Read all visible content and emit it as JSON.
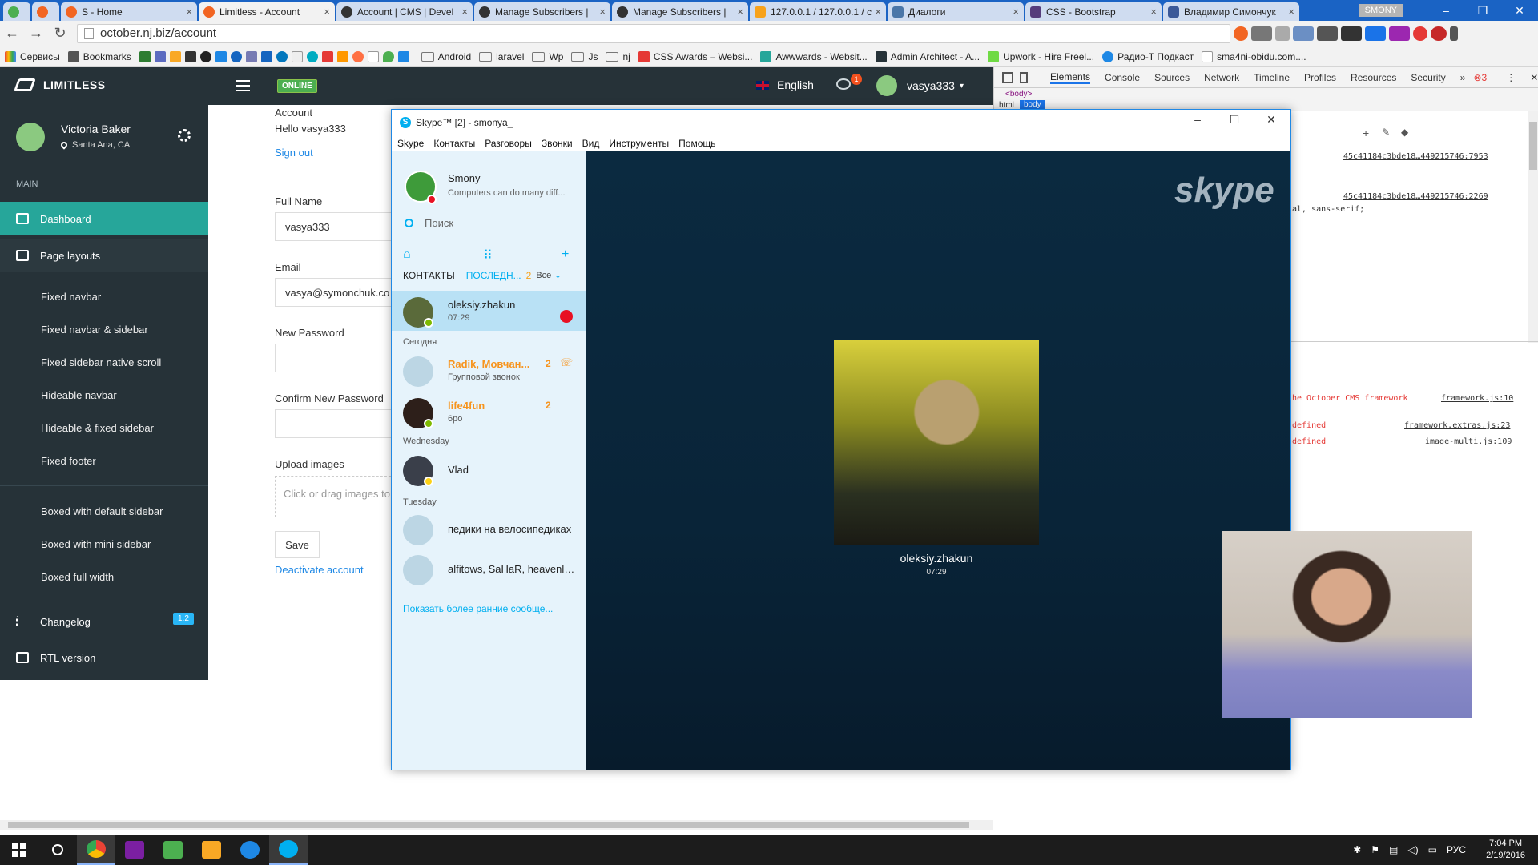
{
  "browser": {
    "tabs": [
      {
        "label": "",
        "color": "#4caf50"
      },
      {
        "label": "",
        "color": "#f26522"
      },
      {
        "label": "S - Home",
        "color": "#f26522"
      },
      {
        "label": "Limitless - Account",
        "color": "#f26522"
      },
      {
        "label": "Account | CMS | Devel",
        "color": "#333333"
      },
      {
        "label": "Manage Subscribers |",
        "color": "#333333"
      },
      {
        "label": "Manage Subscribers |",
        "color": "#333333"
      },
      {
        "label": "127.0.0.1 / 127.0.0.1 / c",
        "color": "#f7a21b"
      },
      {
        "label": "Диалоги",
        "color": "#4a76a8"
      },
      {
        "label": "CSS - Bootstrap",
        "color": "#563d7c"
      },
      {
        "label": "Владимир Симончук",
        "color": "#3b5998"
      }
    ],
    "profile": "SMONY",
    "url": "october.nj.biz/account",
    "bookmarks": [
      "Сервисы",
      "Bookmarks",
      "Android",
      "laravel",
      "Wp",
      "Js",
      "nj",
      "CSS Awards – Websi...",
      "Awwwards - Websit...",
      "Admin Architect - A...",
      "Upwork - Hire Freel...",
      "Радио-Т Подкаст",
      "sma4ni-obidu.com...."
    ]
  },
  "app": {
    "brand": "LIMITLESS",
    "status": "ONLINE",
    "language": "English",
    "notif_count": "1",
    "username": "vasya333"
  },
  "sidebar": {
    "user_name": "Victoria Baker",
    "user_location": "Santa Ana, CA",
    "section": "MAIN",
    "items": [
      {
        "label": "Dashboard"
      },
      {
        "label": "Page layouts"
      },
      {
        "label": "Changelog"
      },
      {
        "label": "RTL version"
      }
    ],
    "sub": [
      "Fixed navbar",
      "Fixed navbar & sidebar",
      "Fixed sidebar native scroll",
      "Hideable navbar",
      "Hideable & fixed sidebar",
      "Fixed footer",
      "Boxed with default sidebar",
      "Boxed with mini sidebar",
      "Boxed full width"
    ],
    "changelog_badge": "1.2"
  },
  "account": {
    "heading": "Account",
    "hello": "Hello vasya333",
    "signout": "Sign out",
    "full_name_label": "Full Name",
    "full_name": "vasya333",
    "email_label": "Email",
    "email": "vasya@symonchuk.co",
    "new_pw_label": "New Password",
    "confirm_pw_label": "Confirm New Password",
    "upload_label": "Upload images",
    "upload_hint": "Click or drag images to",
    "save": "Save",
    "deactivate": "Deactivate account"
  },
  "devtools": {
    "tabs": [
      "Elements",
      "Console",
      "Sources",
      "Network",
      "Timeline",
      "Profiles",
      "Resources",
      "Security"
    ],
    "error_count": "3",
    "crumb_body": "<body>",
    "crumb_html": "html",
    "crumb_sel": "body",
    "link1": "45c41184c3bde18…449215746:7953",
    "link2": "45c41184c3bde18…449215746:2269",
    "code": "al, sans-serif;",
    "errors": [
      {
        "text": "he October CMS framework",
        "src": "framework.js:10"
      },
      {
        "text": "defined",
        "src": "framework.extras.js:23"
      },
      {
        "text": "defined",
        "src": "image-multi.js:109"
      }
    ]
  },
  "skype": {
    "title": "Skype™ [2] - smonya_",
    "menu": [
      "Skype",
      "Контакты",
      "Разговоры",
      "Звонки",
      "Вид",
      "Инструменты",
      "Помощь"
    ],
    "profile_name": "Smony",
    "mood": "Computers can do many diff...",
    "search_placeholder": "Поиск",
    "tab_contacts": "КОНТАКТЫ",
    "tab_recent": "ПОСЛЕДН...",
    "recent_count": "2",
    "filter": "Все",
    "active_call": {
      "name": "oleksiy.zhakun",
      "time": "07:29"
    },
    "sections": [
      "Сегодня",
      "Wednesday",
      "Tuesday"
    ],
    "contacts": [
      {
        "name": "Radik, Мовчан...",
        "sub": "Групповой звонок",
        "count": "2"
      },
      {
        "name": "life4fun",
        "sub": "6ро",
        "count": "2"
      },
      {
        "name": "Vlad",
        "sub": "",
        "count": ""
      },
      {
        "name": "педики на велосипедиках",
        "sub": "",
        "count": ""
      },
      {
        "name": "alfitows, SaHaR, heavenly...",
        "sub": "",
        "count": ""
      }
    ],
    "show_more": "Показать более ранние сообще...",
    "watermark": "skype",
    "remote_name": "oleksiy.zhakun",
    "remote_time": "07:29"
  },
  "taskbar": {
    "lang": "РУС",
    "time": "7:04 PM",
    "date": "2/19/2016"
  }
}
